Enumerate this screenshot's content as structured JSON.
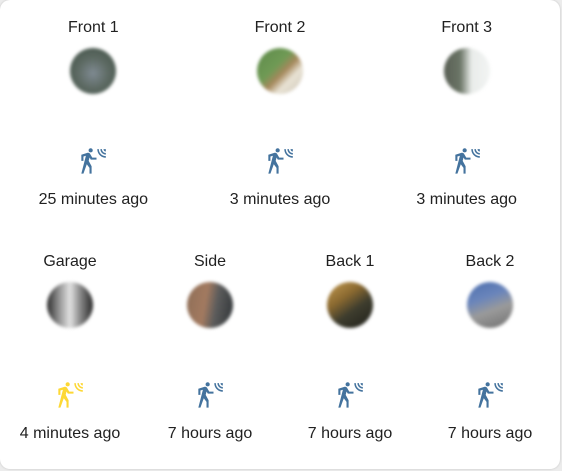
{
  "colors": {
    "motion_idle": "#44739e",
    "motion_active": "#fdd835"
  },
  "cameras": [
    {
      "name": "Front 1",
      "time": "25 minutes ago",
      "motion": "motion-sensor-icon",
      "active": false
    },
    {
      "name": "Front 2",
      "time": "3 minutes ago",
      "motion": "motion-sensor-icon",
      "active": false
    },
    {
      "name": "Front 3",
      "time": "3 minutes ago",
      "motion": "motion-sensor-icon",
      "active": false
    },
    {
      "name": "Garage",
      "time": "4 minutes ago",
      "motion": "motion-sensor-icon",
      "active": true
    },
    {
      "name": "Side",
      "time": "7 hours ago",
      "motion": "motion-sensor-icon",
      "active": false
    },
    {
      "name": "Back 1",
      "time": "7 hours ago",
      "motion": "motion-sensor-icon",
      "active": false
    },
    {
      "name": "Back 2",
      "time": "7 hours ago",
      "motion": "motion-sensor-icon",
      "active": false
    }
  ]
}
